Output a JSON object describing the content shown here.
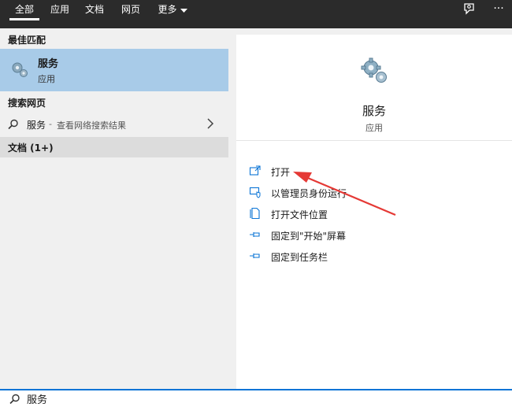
{
  "tabs": [
    {
      "label": "全部",
      "active": true
    },
    {
      "label": "应用",
      "active": false
    },
    {
      "label": "文档",
      "active": false
    },
    {
      "label": "网页",
      "active": false
    },
    {
      "label": "更多",
      "active": false
    }
  ],
  "left": {
    "best_match_header": "最佳匹配",
    "best_item": {
      "title": "服务",
      "subtitle": "应用",
      "icon": "gears-icon"
    },
    "web_header": "搜索网页",
    "web_item": {
      "main": "服务",
      "separator": "-",
      "desc": "查看网络搜索结果",
      "icon": "search-icon"
    },
    "docs_header": "文档 (1+)"
  },
  "right": {
    "title": "服务",
    "subtitle": "应用",
    "actions": [
      {
        "label": "打开",
        "icon": "open-icon"
      },
      {
        "label": "以管理员身份运行",
        "icon": "shield-icon"
      },
      {
        "label": "打开文件位置",
        "icon": "file-location-icon"
      },
      {
        "label": "固定到\"开始\"屏幕",
        "icon": "pin-icon"
      },
      {
        "label": "固定到任务栏",
        "icon": "pin-icon"
      }
    ]
  },
  "search": {
    "value": "服务",
    "icon": "search-icon"
  },
  "colors": {
    "selected": "#a8cbe8",
    "topbar": "#2b2b2b",
    "accent": "#0a74d6",
    "annotation_arrow": "#e53935"
  }
}
